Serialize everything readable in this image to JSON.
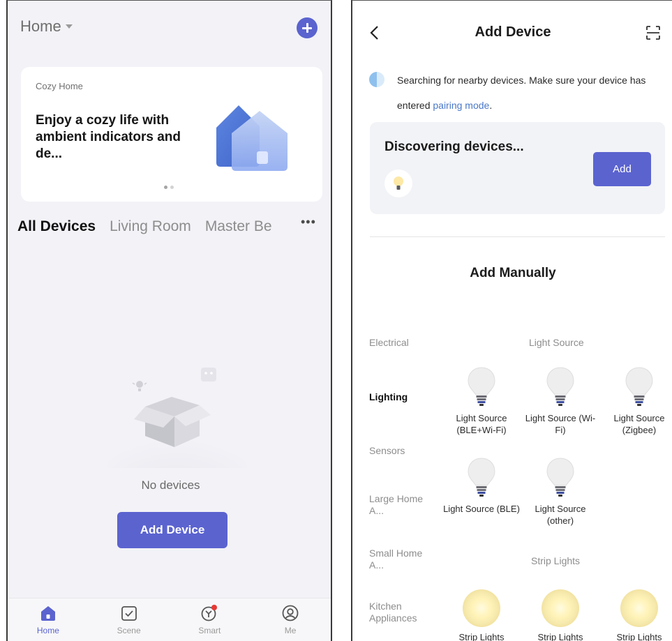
{
  "left": {
    "home_label": "Home",
    "banner": {
      "subtitle": "Cozy Home",
      "headline": "Enjoy a cozy life with ambient indicators and de..."
    },
    "rooms": [
      "All Devices",
      "Living Room",
      "Master Be"
    ],
    "empty_text": "No devices",
    "add_device_label": "Add Device",
    "tabbar": [
      {
        "label": "Home",
        "icon": "home-icon"
      },
      {
        "label": "Scene",
        "icon": "scene-icon"
      },
      {
        "label": "Smart",
        "icon": "smart-icon"
      },
      {
        "label": "Me",
        "icon": "profile-icon"
      }
    ]
  },
  "right": {
    "title": "Add Device",
    "search_text": "Searching for nearby devices. Make sure your device has entered ",
    "pairing_link": "pairing mode",
    "period": ".",
    "discover_title": "Discovering devices...",
    "add_label": "Add",
    "manual_title": "Add Manually",
    "categories": [
      "Electrical",
      "Lighting",
      "Sensors",
      "Large Home A...",
      "Small Home A...",
      "Kitchen Appliances"
    ],
    "section_light_source": "Light Source",
    "section_strip_lights": "Strip Lights",
    "devices": [
      {
        "name": "Light Source (BLE+Wi-Fi)"
      },
      {
        "name": "Light Source (Wi-Fi)"
      },
      {
        "name": "Light Source (Zigbee)"
      },
      {
        "name": "Light Source (BLE)"
      },
      {
        "name": "Light Source (other)"
      }
    ],
    "strips": [
      {
        "name": "Strip Lights"
      },
      {
        "name": "Strip Lights"
      },
      {
        "name": "Strip Lights"
      }
    ]
  },
  "colors": {
    "accent": "#5b63cf",
    "link": "#4a78c8",
    "badge": "#e53935",
    "screen_bg": "#f2f2f7"
  }
}
